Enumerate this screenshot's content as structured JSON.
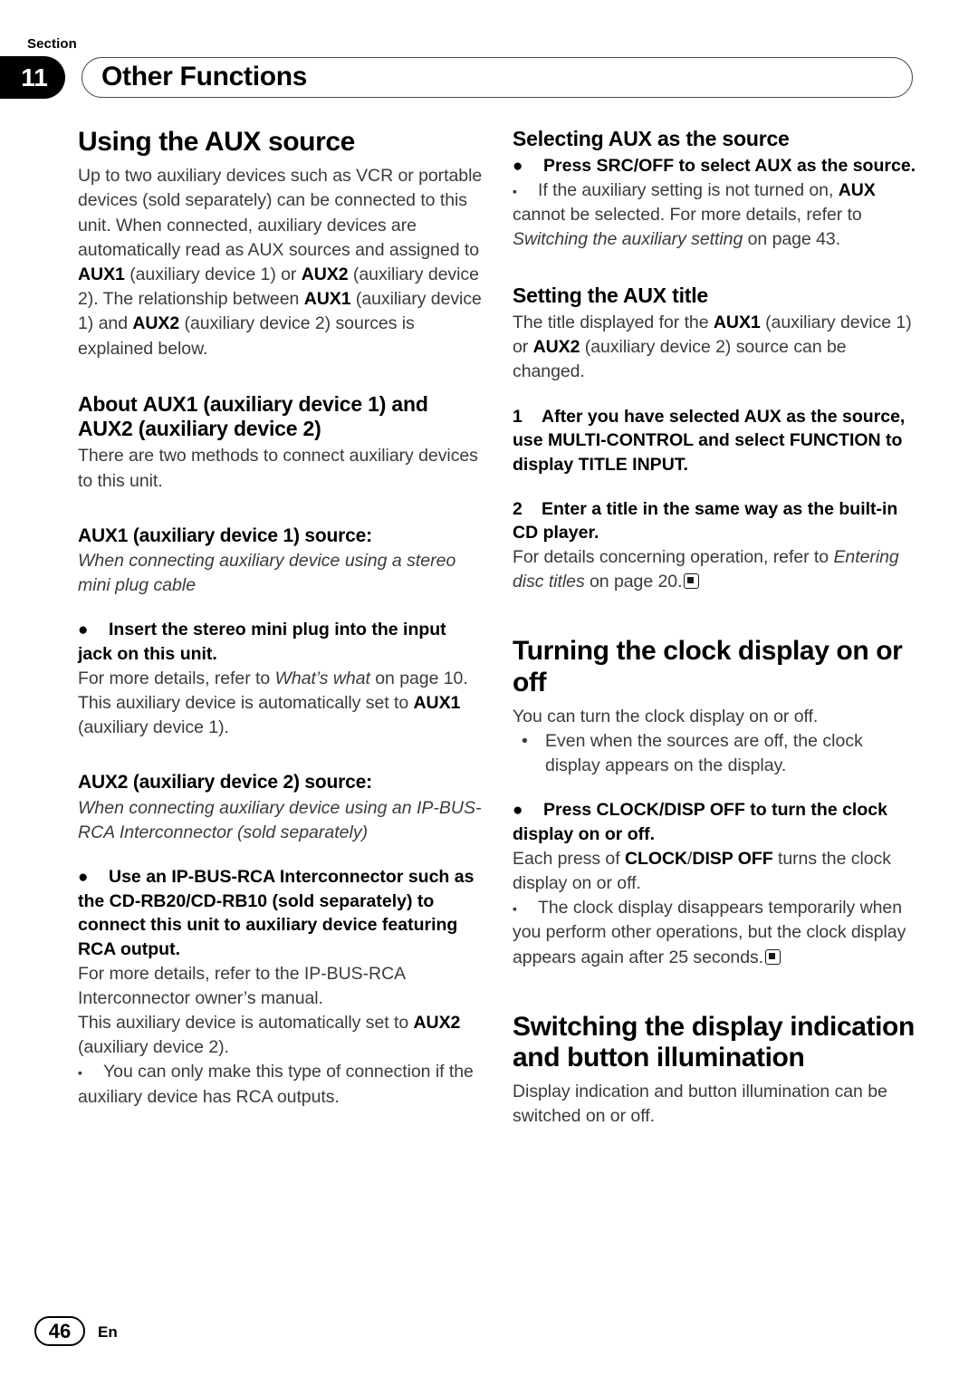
{
  "header": {
    "section_label": "Section",
    "section_number": "11",
    "title": "Other Functions"
  },
  "footer": {
    "page_number": "46",
    "language": "En"
  },
  "left_column": {
    "heading": "Using the AUX source",
    "intro_parts": [
      "Up to two auxiliary devices such as VCR or portable devices (sold separately) can be connected to this unit. When connected, auxiliary devices are automatically read as AUX sources and assigned to ",
      "AUX1",
      " (auxiliary device 1) or ",
      "AUX2",
      " (auxiliary device 2). The relationship between ",
      "AUX1",
      " (auxiliary device 1) and ",
      "AUX2",
      " (auxiliary device 2) sources is explained below."
    ],
    "about_heading_1": "About ",
    "about_heading_2": "AUX1",
    "about_heading_3": " (auxiliary device 1) and ",
    "about_heading_4": "AUX2",
    "about_heading_5": " (auxiliary device 2)",
    "about_body": "There are two methods to connect auxiliary devices to this unit.",
    "aux1_heading": "AUX1 (auxiliary device 1) source:",
    "aux1_italic": "When connecting auxiliary device using a stereo mini plug cable",
    "aux1_bullet": "Insert the stereo mini plug into the input jack on this unit.",
    "aux1_detail_1": "For more details, refer to ",
    "aux1_detail_2": "What’s what",
    "aux1_detail_3": " on page 10.",
    "aux1_auto_1": "This auxiliary device is automatically set to ",
    "aux1_auto_2": "AUX1",
    "aux1_auto_3": " (auxiliary device 1).",
    "aux2_heading": "AUX2 (auxiliary device 2) source:",
    "aux2_italic": "When connecting auxiliary device using an IP-BUS-RCA Interconnector (sold separately)",
    "aux2_bullet": "Use an IP-BUS-RCA Interconnector such as the CD-RB20/CD-RB10 (sold separately) to connect this unit to auxiliary device featuring RCA output.",
    "aux2_detail": "For more details, refer to the IP-BUS-RCA Interconnector owner’s manual.",
    "aux2_auto_1": "This auxiliary device is automatically set to ",
    "aux2_auto_2": "AUX2",
    "aux2_auto_3": " (auxiliary device 2).",
    "aux2_note": "You can only make this type of connection if the auxiliary device has RCA outputs."
  },
  "right_column": {
    "select_heading": "Selecting AUX as the source",
    "select_bullet": "Press SRC/OFF to select AUX as the source.",
    "select_note_1": "If the auxiliary setting is not turned on, ",
    "select_note_2": "AUX",
    "select_note_3": " cannot be selected. For more details, refer to ",
    "select_note_4": "Switching the auxiliary setting",
    "select_note_5": " on page 43.",
    "title_heading": "Setting the AUX title",
    "title_body_1": "The title displayed for the ",
    "title_body_2": "AUX1",
    "title_body_3": " (auxiliary device 1) or ",
    "title_body_4": "AUX2",
    "title_body_5": " (auxiliary device 2) source can be changed.",
    "step1_num": "1",
    "step1_text": "After you have selected AUX as the source, use MULTI-CONTROL and select FUNCTION to display TITLE INPUT.",
    "step2_num": "2",
    "step2_text": "Enter a title in the same way as the built-in CD player.",
    "step2_detail_1": "For details concerning operation, refer to ",
    "step2_detail_2": "Entering disc titles",
    "step2_detail_3": " on page 20.",
    "clock_heading": "Turning the clock display on or off",
    "clock_body": "You can turn the clock display on or off.",
    "clock_bullet_round": "Even when the sources are off, the clock display appears on the display.",
    "clock_bullet": "Press CLOCK/DISP OFF to turn the clock display on or off.",
    "clock_each_1": "Each press of ",
    "clock_each_2": "CLOCK",
    "clock_each_3": "/",
    "clock_each_4": "DISP OFF",
    "clock_each_5": " turns the clock display on or off.",
    "clock_note": "The clock display disappears temporarily when you perform other operations, but the clock display appears again after 25 seconds.",
    "switch_heading": "Switching the display indication and button illumination",
    "switch_body": "Display indication and button illumination can be switched on or off."
  },
  "glyphs": {
    "bullet_dot": "●",
    "note_square": "▪",
    "round_bullet": "•"
  }
}
